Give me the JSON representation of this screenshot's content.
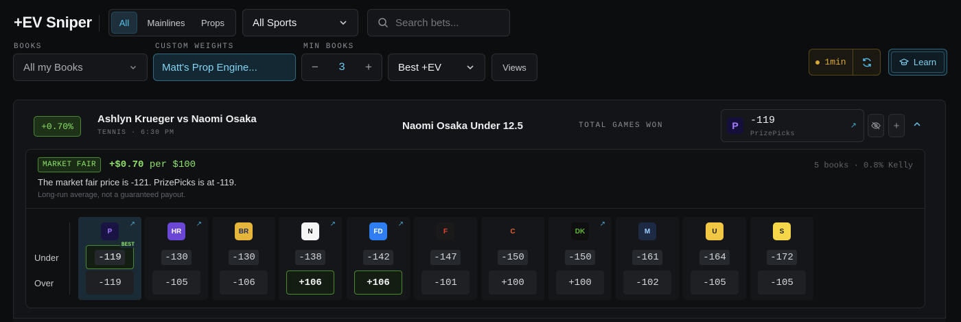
{
  "app_title": "+EV Sniper",
  "filter_tabs": [
    {
      "label": "All",
      "active": true
    },
    {
      "label": "Mainlines",
      "active": false
    },
    {
      "label": "Props",
      "active": false
    }
  ],
  "sports_select": {
    "value": "All Sports",
    "icon": "chevron-down-icon"
  },
  "search": {
    "placeholder": "Search bets...",
    "value": ""
  },
  "books": {
    "label": "BOOKS",
    "value": "All my Books"
  },
  "custom_weights": {
    "label": "CUSTOM WEIGHTS",
    "value": "Matt's Prop Engine..."
  },
  "min_books": {
    "label": "MIN BOOKS",
    "value": "3",
    "minus": "−",
    "plus": "+"
  },
  "sort_select": {
    "value": "Best +EV"
  },
  "views_button": "Views",
  "refresh": {
    "interval": "1min"
  },
  "learn_button": "Learn",
  "bet": {
    "ev_badge": "+0.70%",
    "matchup": "Ashlyn Krueger vs Naomi Osaka",
    "meta": "TENNIS · 6:30 PM",
    "pick": "Naomi Osaka Under 12.5",
    "market": "TOTAL GAMES WON",
    "best_odds": "-119",
    "best_book": "PrizePicks"
  },
  "detail": {
    "tag": "MARKET FAIR",
    "ev_amount": "+$0.70",
    "ev_suffix": "per $100",
    "stats": "5 books · 0.8% Kelly",
    "description": "The market fair price is -121. PrizePicks is at -119.",
    "note": "Long-run average, not a guaranteed payout."
  },
  "rows": {
    "under": "Under",
    "over": "Over"
  },
  "best_label": "BEST",
  "books_list": [
    {
      "name": "PrizePicks",
      "logo_text": "P",
      "logo_bg": "#1a1445",
      "logo_fg": "#a77bff",
      "under": "-119",
      "over": "-119",
      "link": true,
      "best": true
    },
    {
      "name": "Hard Rock Bet",
      "logo_text": "HR",
      "logo_bg": "#6b47d6",
      "logo_fg": "#ffffff",
      "under": "-130",
      "over": "-105",
      "link": true
    },
    {
      "name": "Bet Rivers",
      "logo_text": "BR",
      "logo_bg": "#e6b63c",
      "logo_fg": "#1a2a5a",
      "under": "-130",
      "over": "-106",
      "link": false
    },
    {
      "name": "Novig",
      "logo_text": "N",
      "logo_bg": "#f5f5f5",
      "logo_fg": "#000000",
      "under": "-138",
      "over": "+106",
      "link": true,
      "over_hl": true
    },
    {
      "name": "FanDuel",
      "logo_text": "FD",
      "logo_bg": "#2f7df3",
      "logo_fg": "#ffffff",
      "under": "-142",
      "over": "+106",
      "link": true,
      "over_hl": true
    },
    {
      "name": "Fanatics",
      "logo_text": "F",
      "logo_bg": "#1a1a1a",
      "logo_fg": "#e8452c",
      "under": "-147",
      "over": "-101",
      "link": false
    },
    {
      "name": "Caesars",
      "logo_text": "C",
      "logo_bg": "#15161a",
      "logo_fg": "#e8602c",
      "under": "-150",
      "over": "+100",
      "link": false
    },
    {
      "name": "DraftKings",
      "logo_text": "DK",
      "logo_bg": "#0f0f0f",
      "logo_fg": "#5fb83b",
      "under": "-150",
      "over": "+100",
      "link": true
    },
    {
      "name": "BetMGM",
      "logo_text": "M",
      "logo_bg": "#1e2a44",
      "logo_fg": "#9ad0ff",
      "under": "-161",
      "over": "-102",
      "link": false
    },
    {
      "name": "Underdog",
      "logo_text": "U",
      "logo_bg": "#f2c744",
      "logo_fg": "#1a1a1a",
      "under": "-164",
      "over": "-105",
      "link": false
    },
    {
      "name": "Sleeper",
      "logo_text": "S",
      "logo_bg": "#f7d74a",
      "logo_fg": "#1a1a1a",
      "under": "-172",
      "over": "-105",
      "link": false
    }
  ]
}
